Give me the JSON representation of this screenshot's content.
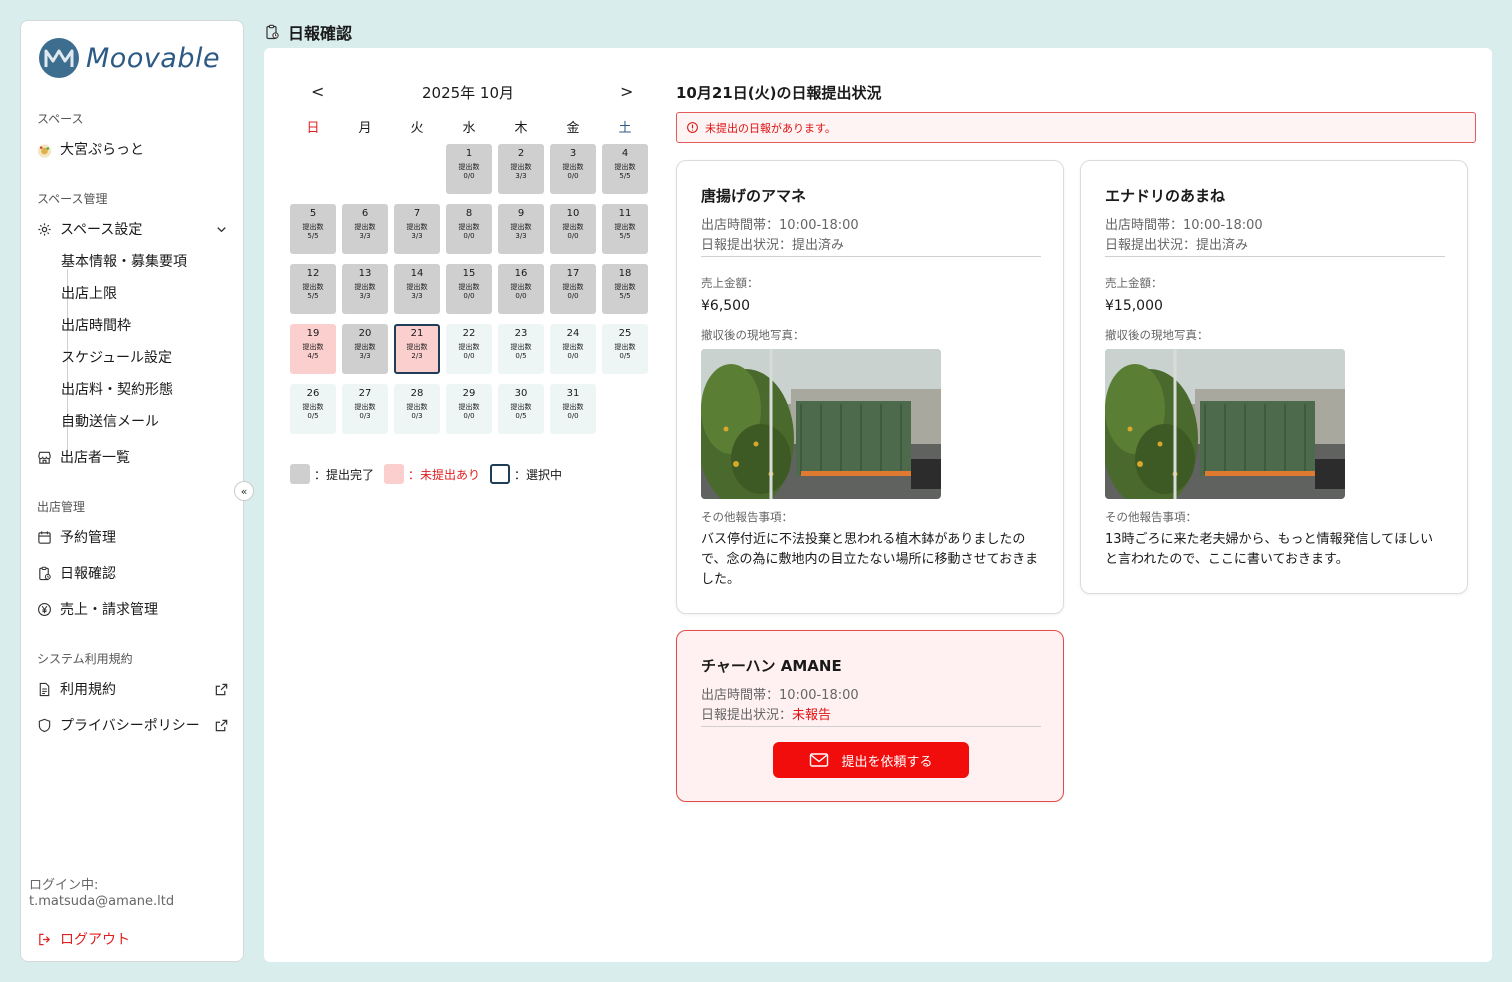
{
  "brand": {
    "name": "Moovable"
  },
  "sidebar": {
    "space_label": "スペース",
    "space_name": "大宮ぷらっと",
    "space_mgmt_label": "スペース管理",
    "space_settings": "スペース設定",
    "sub_items": [
      "基本情報・募集要項",
      "出店上限",
      "出店時間枠",
      "スケジュール設定",
      "出店料・契約形態",
      "自動送信メール"
    ],
    "vendor_list": "出店者一覧",
    "store_mgmt_label": "出店管理",
    "reservation": "予約管理",
    "daily_report": "日報確認",
    "sales": "売上・請求管理",
    "terms_label": "システム利用規約",
    "terms": "利用規約",
    "privacy": "プライバシーポリシー",
    "collapse": "«",
    "login_label": "ログイン中:",
    "login_email": "t.matsuda@amane.ltd",
    "logout": "ログアウト"
  },
  "header": {
    "title": "日報確認"
  },
  "calendar": {
    "prev": "<",
    "next": ">",
    "month_label": "2025年 10月",
    "weekdays": [
      "日",
      "月",
      "火",
      "水",
      "木",
      "金",
      "土"
    ],
    "count_label": "提出数",
    "days": [
      {
        "d": "1",
        "c": "0/0",
        "s": "done"
      },
      {
        "d": "2",
        "c": "3/3",
        "s": "done"
      },
      {
        "d": "3",
        "c": "0/0",
        "s": "done"
      },
      {
        "d": "4",
        "c": "5/5",
        "s": "done"
      },
      {
        "d": "5",
        "c": "5/5",
        "s": "done"
      },
      {
        "d": "6",
        "c": "3/3",
        "s": "done"
      },
      {
        "d": "7",
        "c": "3/3",
        "s": "done"
      },
      {
        "d": "8",
        "c": "0/0",
        "s": "done"
      },
      {
        "d": "9",
        "c": "3/3",
        "s": "done"
      },
      {
        "d": "10",
        "c": "0/0",
        "s": "done"
      },
      {
        "d": "11",
        "c": "5/5",
        "s": "done"
      },
      {
        "d": "12",
        "c": "5/5",
        "s": "done"
      },
      {
        "d": "13",
        "c": "3/3",
        "s": "done"
      },
      {
        "d": "14",
        "c": "3/3",
        "s": "done"
      },
      {
        "d": "15",
        "c": "0/0",
        "s": "done"
      },
      {
        "d": "16",
        "c": "0/0",
        "s": "done"
      },
      {
        "d": "17",
        "c": "0/0",
        "s": "done"
      },
      {
        "d": "18",
        "c": "5/5",
        "s": "done"
      },
      {
        "d": "19",
        "c": "4/5",
        "s": "pending"
      },
      {
        "d": "20",
        "c": "3/3",
        "s": "done"
      },
      {
        "d": "21",
        "c": "2/3",
        "s": "pending",
        "selected": true
      },
      {
        "d": "22",
        "c": "0/0",
        "s": "future"
      },
      {
        "d": "23",
        "c": "0/5",
        "s": "future"
      },
      {
        "d": "24",
        "c": "0/0",
        "s": "future"
      },
      {
        "d": "25",
        "c": "0/5",
        "s": "future"
      },
      {
        "d": "26",
        "c": "0/5",
        "s": "future"
      },
      {
        "d": "27",
        "c": "0/3",
        "s": "future"
      },
      {
        "d": "28",
        "c": "0/3",
        "s": "future"
      },
      {
        "d": "29",
        "c": "0/0",
        "s": "future"
      },
      {
        "d": "30",
        "c": "0/5",
        "s": "future"
      },
      {
        "d": "31",
        "c": "0/0",
        "s": "future"
      }
    ],
    "first_weekday": 3,
    "legend": {
      "done": "：提出完了",
      "pending": "：未提出あり",
      "selected": "：選択中"
    }
  },
  "status": {
    "title": "10月21日(火)の日報提出状況",
    "alert": "未提出の日報があります。",
    "hours_label": "出店時間帯：",
    "report_label": "日報提出状況：",
    "sales_label": "売上金額：",
    "photo_label": "撤収後の現地写真：",
    "note_label": "その他報告事項：",
    "request_button": "提出を依頼する",
    "cards": [
      {
        "name": "唐揚げのアマネ",
        "hours": "10:00-18:00",
        "report_status": "提出済み",
        "amount": "¥6,500",
        "note": "バス停付近に不法投棄と思われる植木鉢がありましたので、念の為に敷地内の目立たない場所に移動させておきました。"
      },
      {
        "name": "エナドリのあまね",
        "hours": "10:00-18:00",
        "report_status": "提出済み",
        "amount": "¥15,000",
        "note": "13時ごろに来た老夫婦から、もっと情報発信してほしいと言われたので、ここに書いておきます。"
      },
      {
        "name": "チャーハン AMANE",
        "hours": "10:00-18:00",
        "report_status": "未報告"
      }
    ]
  },
  "colors": {
    "accent": "#2d5a85",
    "danger": "#f20d0d",
    "done": "#cfcfcf",
    "pending": "#fccfcf",
    "future": "#eef6f5",
    "selected_border": "#1e3d59"
  }
}
